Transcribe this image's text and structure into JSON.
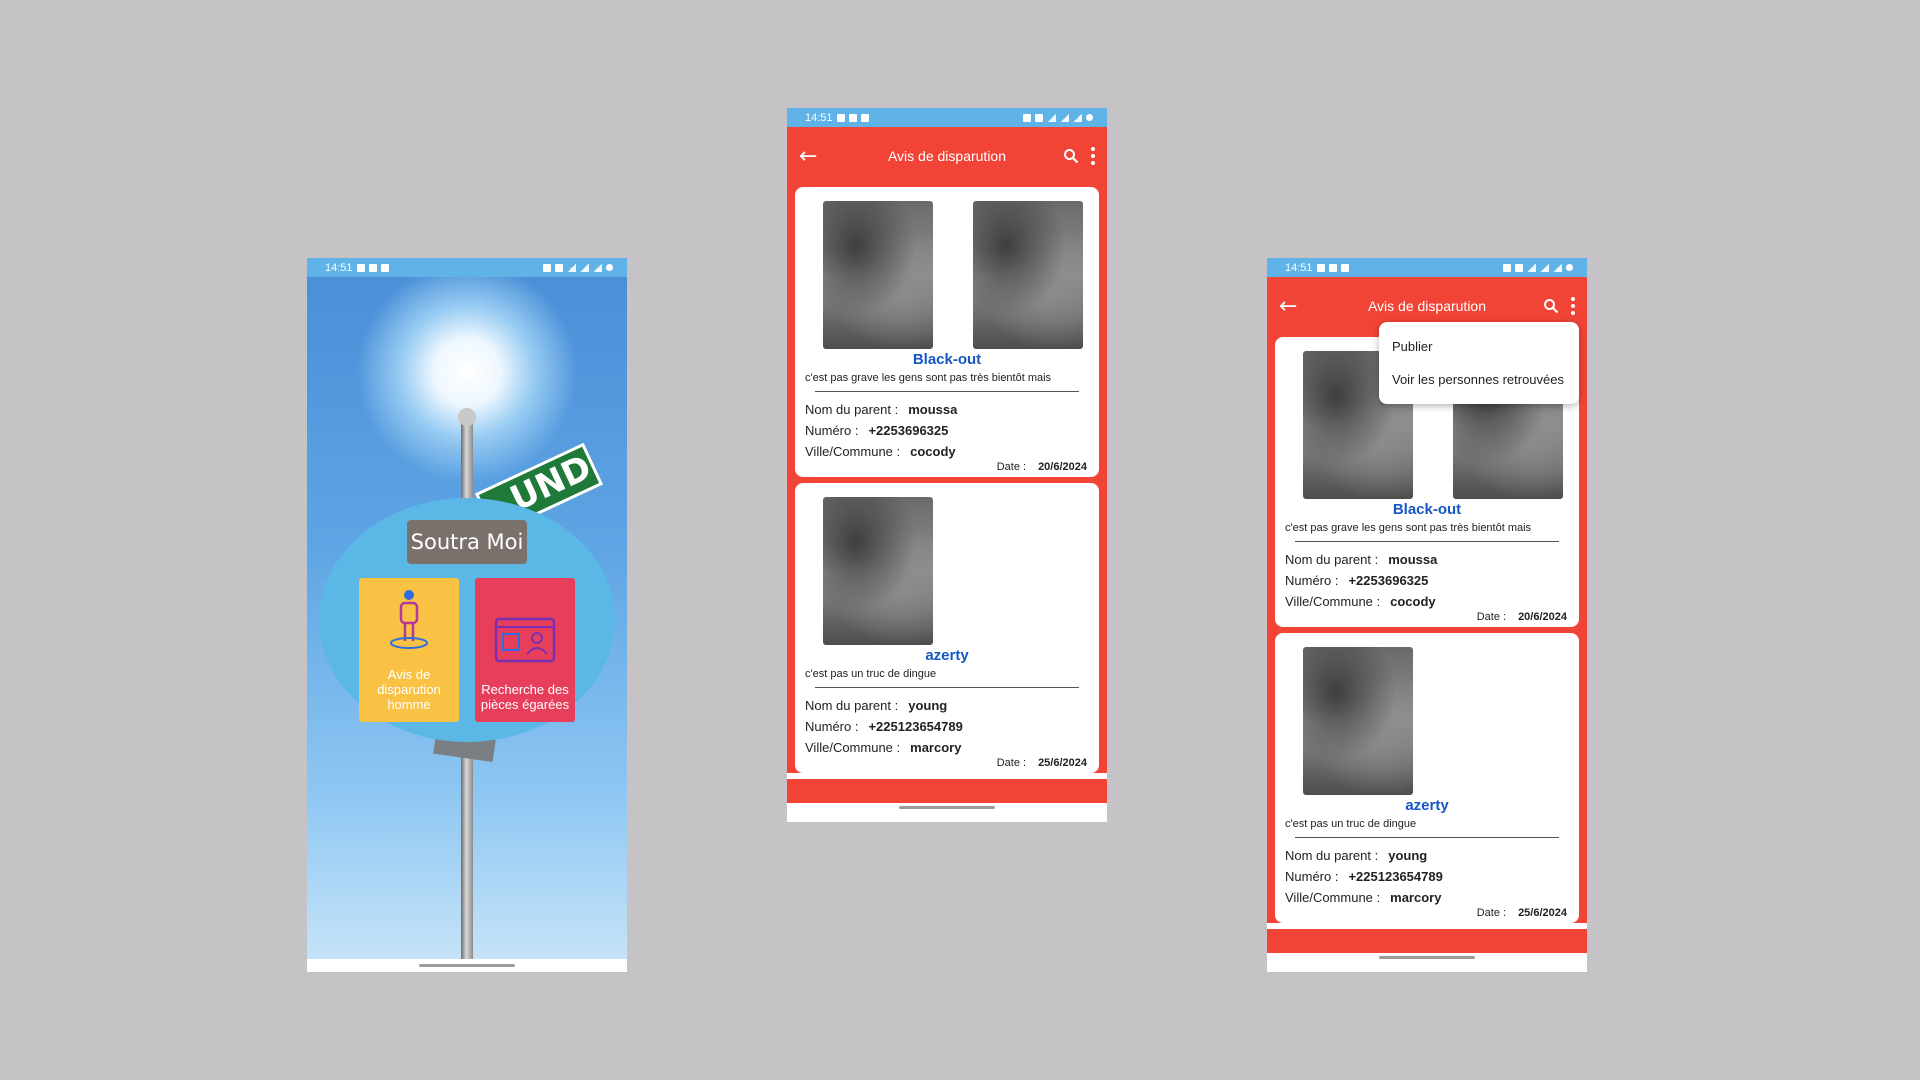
{
  "status": {
    "time": "14:51"
  },
  "home": {
    "app_title": "Soutra Moi",
    "sign_text": "UND",
    "tiles": [
      {
        "label": "Avis de disparution homme",
        "color": "#f9c245",
        "icon": "person-pin-icon"
      },
      {
        "label": "Recherche des pièces égarées",
        "color": "#e73f5b",
        "icon": "id-card-icon"
      }
    ]
  },
  "list": {
    "title": "Avis de disparution",
    "accent": "#f24436",
    "name_color": "#1657c4",
    "labels": {
      "parent": "Nom du parent :",
      "numero": "Numéro :",
      "ville": "Ville/Commune :",
      "date": "Date :"
    },
    "cards": [
      {
        "name": "Black-out",
        "desc": "c'est pas grave les gens sont pas très bientôt mais",
        "parent": "moussa",
        "numero": "+2253696325",
        "ville": "cocody",
        "date": "20/6/2024"
      },
      {
        "name": "azerty",
        "desc": "c'est pas un truc de dingue",
        "parent": "young",
        "numero": "+225123654789",
        "ville": "marcory",
        "date": "25/6/2024"
      }
    ]
  },
  "menu": {
    "items": [
      "Publier",
      "Voir les personnes retrouvées"
    ]
  }
}
